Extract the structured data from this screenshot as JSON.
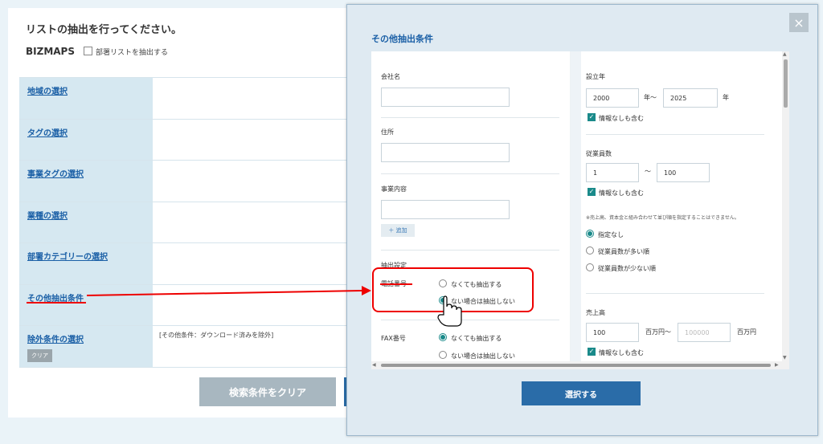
{
  "background": {
    "title": "リストの抽出を行ってください。",
    "brand": "BIZMAPS",
    "dept_checkbox_label": "部署リストを抽出する",
    "rows": [
      {
        "label": "地域の選択",
        "value": ""
      },
      {
        "label": "タグの選択",
        "value": ""
      },
      {
        "label": "事業タグの選択",
        "value": ""
      },
      {
        "label": "業種の選択",
        "value": ""
      },
      {
        "label": "部署カテゴリーの選択",
        "value": ""
      },
      {
        "label": "その他抽出条件",
        "value": ""
      },
      {
        "label": "除外条件の選択",
        "value": "[その他条件：ダウンロード済みを除外]"
      }
    ],
    "clear_mini": "クリア",
    "clear_button": "検索条件をクリア"
  },
  "modal": {
    "title": "その他抽出条件",
    "close_icon": "×",
    "select_button": "選択する",
    "left": {
      "company_label": "会社名",
      "address_label": "住所",
      "business_label": "事業内容",
      "add_button": "＋ 追加",
      "extraction_label": "抽出設定",
      "phone_label": "電話番号",
      "phone_opt1": "なくても抽出する",
      "phone_opt2": "ない場合は抽出しない",
      "fax_label": "FAX番号",
      "fax_opt1": "なくても抽出する",
      "fax_opt2": "ない場合は抽出しない"
    },
    "right": {
      "founded_label": "設立年",
      "founded_from": "2000",
      "founded_from_unit": "年〜",
      "founded_to": "2025",
      "founded_to_unit": "年",
      "founded_include": "情報なしも含む",
      "employees_label": "従業員数",
      "employees_from": "1",
      "employees_tilde": "〜",
      "employees_to": "100",
      "employees_include": "情報なしも含む",
      "note": "※売上高、資本金と組み合わせて並び順を指定することはできません。",
      "sort_opt1": "指定なし",
      "sort_opt2": "従業員数が多い順",
      "sort_opt3": "従業員数が少ない順",
      "sales_label": "売上高",
      "sales_from": "100",
      "sales_from_unit": "百万円〜",
      "sales_to_placeholder": "100000",
      "sales_to_unit": "百万円",
      "sales_include": "情報なしも含む"
    }
  }
}
